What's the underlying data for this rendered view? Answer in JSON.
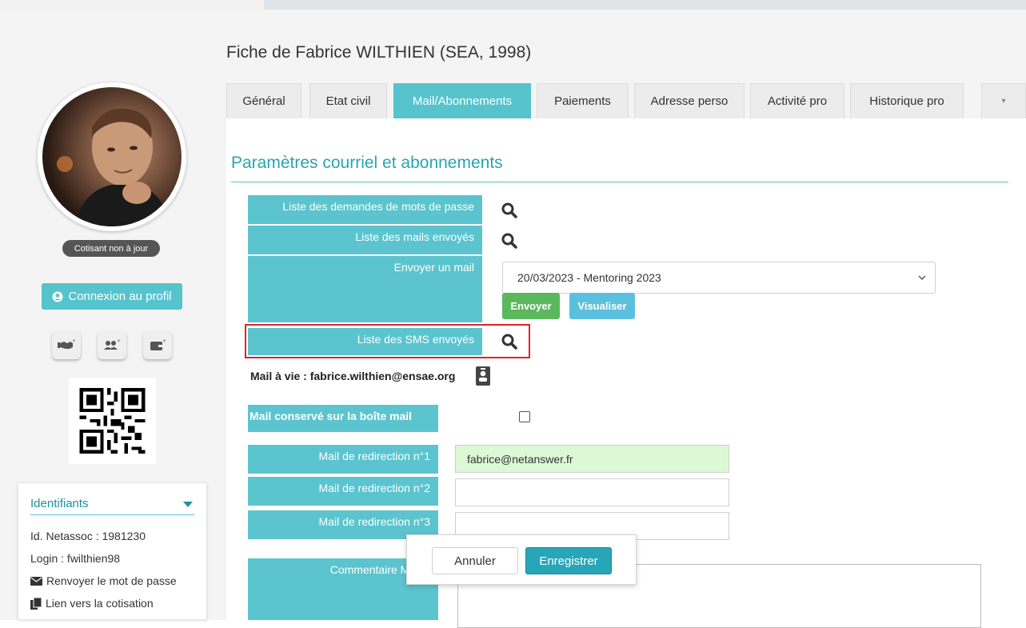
{
  "page": {
    "title": "Fiche de Fabrice WILTHIEN (SEA, 1998)"
  },
  "tabs": [
    {
      "label": "Général"
    },
    {
      "label": "Etat civil"
    },
    {
      "label": "Mail/Abonnements",
      "active": true
    },
    {
      "label": "Paiements"
    },
    {
      "label": "Adresse perso"
    },
    {
      "label": "Activité pro"
    },
    {
      "label": "Historique pro"
    },
    {
      "label": "▾"
    }
  ],
  "section": {
    "title": "Paramètres courriel et abonnements"
  },
  "rows": {
    "pw_requests": "Liste des demandes de mots de passe",
    "mails_sent": "Liste des mails envoyés",
    "send_mail": "Envoyer un mail",
    "sms_sent": "Liste des SMS envoyés"
  },
  "mail_select": {
    "value": "20/03/2023 - Mentoring 2023"
  },
  "buttons": {
    "send": "Envoyer",
    "preview": "Visualiser",
    "cancel": "Annuler",
    "save": "Enregistrer"
  },
  "mail_a_vie": {
    "label": "Mail à vie :",
    "value": "fabrice.wilthien@ensae.org"
  },
  "mail_conserve": {
    "label": "Mail conservé sur la boîte mail",
    "checked": false
  },
  "redirects": [
    {
      "label": "Mail de redirection n°1",
      "value": "fabrice@netanswer.fr"
    },
    {
      "label": "Mail de redirection n°2",
      "value": ""
    },
    {
      "label": "Mail de redirection n°3",
      "value": ""
    }
  ],
  "comment": {
    "label": "Commentaire Mail à",
    "value": ""
  },
  "profile": {
    "status": "Cotisant non à jour",
    "connect_button": "Connexion au profil",
    "icons": [
      "handshake-plus-icon",
      "users-plus-icon",
      "wallet-plus-icon"
    ]
  },
  "identifiants": {
    "title": "Identifiants",
    "netassoc": "Id. Netassoc : 1981230",
    "login": "Login : fwilthien98",
    "resend_password": "Renvoyer le mot de passe",
    "membership_link": "Lien vers la cotisation"
  },
  "colors": {
    "accent": "#56c3cd",
    "accent_dark": "#27a6b8",
    "green": "#5cb85c",
    "red_highlight": "#e02424"
  }
}
